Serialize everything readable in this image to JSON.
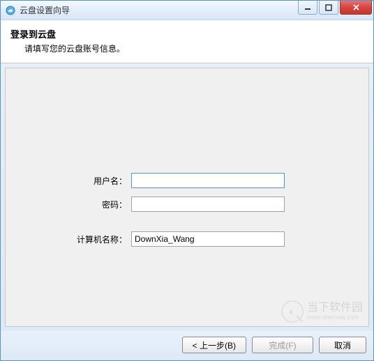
{
  "window": {
    "title": "云盘设置向导"
  },
  "header": {
    "title": "登录到云盘",
    "subtitle": "请填写您的云盘账号信息。"
  },
  "form": {
    "username_label": "用户名：",
    "username_value": "",
    "password_label": "密码：",
    "password_value": "",
    "computer_label": "计算机名称：",
    "computer_value": "DownXia_Wang"
  },
  "buttons": {
    "back": "< 上一步(B)",
    "finish": "完成(F)",
    "cancel": "取消"
  },
  "watermark": {
    "text": "当下软件园",
    "sub": "www.downxia.com"
  }
}
